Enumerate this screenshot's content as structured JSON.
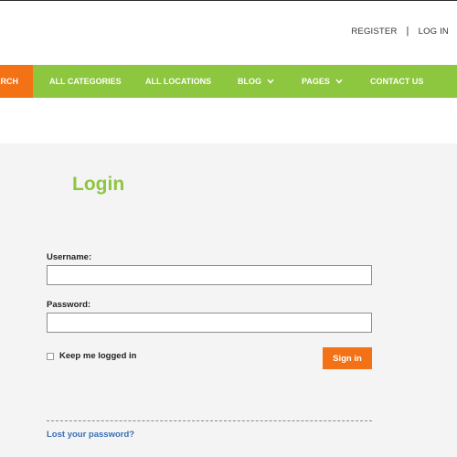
{
  "header": {
    "register_label": "REGISTER",
    "separator": "|",
    "login_label": "LOG IN"
  },
  "nav": {
    "search_label": "SEARCH",
    "items": [
      {
        "label": "ALL CATEGORIES"
      },
      {
        "label": "ALL LOCATIONS"
      },
      {
        "label": "BLOG",
        "icon": "chevron-down-icon"
      },
      {
        "label": "PAGES",
        "icon": "chevron-down-icon"
      },
      {
        "label": "CONTACT US"
      }
    ]
  },
  "login": {
    "title": "Login",
    "username_label": "Username:",
    "username_value": "",
    "password_label": "Password:",
    "password_value": "",
    "remember_label": "Keep me logged in",
    "remember_checked": false,
    "signin_label": "Sign in",
    "lost_password_label": "Lost your password?"
  },
  "colors": {
    "accent_green": "#8dc63f",
    "accent_orange": "#f47216",
    "link_blue": "#3a6fb6",
    "content_bg": "#f4f4f4"
  }
}
